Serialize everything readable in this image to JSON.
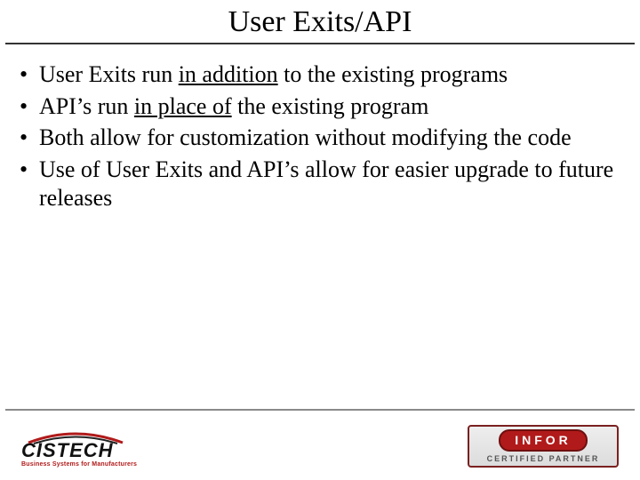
{
  "title": "User Exits/API",
  "bullets": [
    {
      "pre": "User Exits run ",
      "u": "in addition",
      "post": " to the existing programs"
    },
    {
      "pre": "API’s run ",
      "u": "in place of",
      "post": " the existing program"
    },
    {
      "pre": "Both allow for customization without modifying the code",
      "u": "",
      "post": ""
    },
    {
      "pre": "Use of User Exits and API’s allow for easier upgrade to future releases",
      "u": "",
      "post": ""
    }
  ],
  "footer": {
    "cistech": {
      "word": "CISTECH",
      "tagline": "Business Systems for Manufacturers"
    },
    "infor": {
      "brand": "INFOR",
      "sub": "CERTIFIED PARTNER"
    }
  }
}
